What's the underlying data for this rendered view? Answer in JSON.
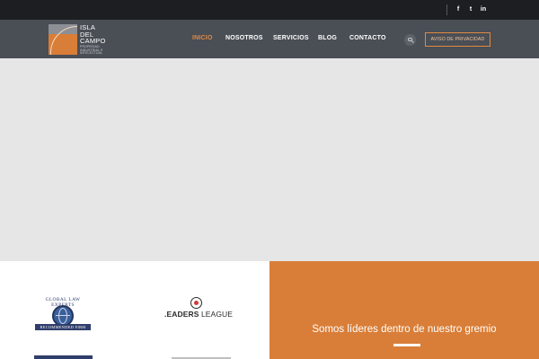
{
  "top_bar": {
    "social": [
      {
        "name": "facebook-icon",
        "glyph": "f"
      },
      {
        "name": "twitter-icon",
        "glyph": "t"
      },
      {
        "name": "linkedin-icon",
        "glyph": "in"
      }
    ]
  },
  "logo": {
    "lines": [
      "ISLA",
      "DEL",
      "CAMPO"
    ],
    "subtitle_lines": [
      "PROPIEDAD",
      "INDUSTRIAL E",
      "INTELECTUAL"
    ]
  },
  "nav": {
    "items": [
      {
        "label": "INICIO",
        "active": true
      },
      {
        "label": "NOSOTROS",
        "active": false
      },
      {
        "label": "SERVICIOS",
        "active": false
      },
      {
        "label": "BLOG",
        "active": false
      },
      {
        "label": "CONTACTO",
        "active": false
      }
    ],
    "cta_label": "AVISO DE PRIVACIDAD"
  },
  "badges": {
    "global_law_experts": {
      "arch_text": "GLOBAL LAW EXPERTS",
      "ribbon_text": "RECOMMENDED FIRM"
    },
    "leaders_league": {
      "prefix": ".EADERS",
      "suffix": " LEAGUE"
    }
  },
  "promo": {
    "title": "Somos líderes dentro de nuestro gremio"
  },
  "colors": {
    "accent": "#d97e38",
    "navbar": "#4a4e55",
    "topbar": "#1c1e21",
    "hero": "#e6e6e6"
  }
}
